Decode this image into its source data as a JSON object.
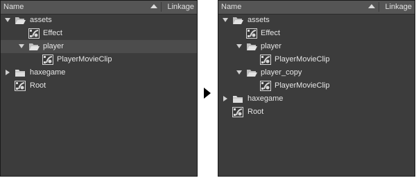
{
  "header": {
    "name_label": "Name",
    "linkage_label": "Linkage"
  },
  "left_tree": {
    "assets": "assets",
    "effect": "Effect",
    "player": "player",
    "player_movieclip": "PlayerMovieClip",
    "haxegame": "haxegame",
    "root": "Root"
  },
  "right_tree": {
    "assets": "assets",
    "effect": "Effect",
    "player": "player",
    "player_movieclip": "PlayerMovieClip",
    "player_copy": "player_copy",
    "player_copy_movieclip": "PlayerMovieClip",
    "haxegame": "haxegame",
    "root": "Root"
  },
  "icons": {
    "folder_open": "open-folder-icon",
    "folder_closed": "folder-icon",
    "symbol": "movieclip-symbol-icon",
    "expand": "triangle-right-icon",
    "collapse": "triangle-down-icon",
    "sort": "sort-ascending-icon",
    "transition": "transition-arrow-icon"
  },
  "colors": {
    "panel_bg": "#3c3c3c",
    "header_bg": "#555555",
    "selected_row": "#4c4c4c",
    "text": "#e6e6e6"
  }
}
